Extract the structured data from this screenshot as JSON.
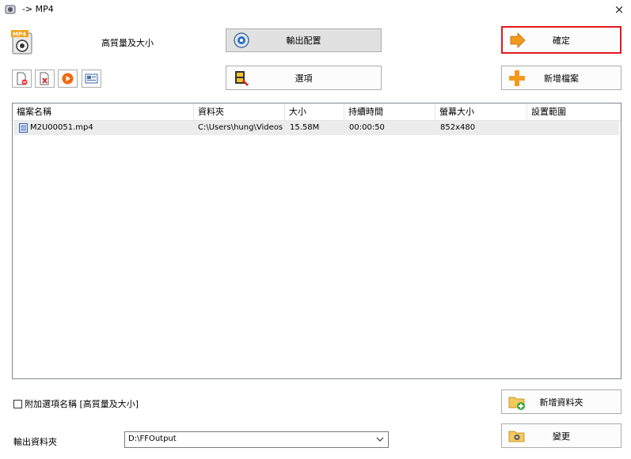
{
  "window": {
    "title": "-> MP4",
    "close_symbol": "×"
  },
  "profile": {
    "name": "高質量及大小"
  },
  "buttons": {
    "output_settings": "輸出配置",
    "options": "選項",
    "ok": "確定",
    "add_file": "新增檔案",
    "add_folder": "新增資料夾",
    "change": "變更"
  },
  "toolbar": [
    "remove-file-icon",
    "clear-list-icon",
    "play-icon",
    "media-info-icon"
  ],
  "list": {
    "columns": [
      "檔案名稱",
      "資料夾",
      "大小",
      "持續時間",
      "螢幕大小",
      "設置範圍"
    ],
    "rows": [
      {
        "name": "M2U00051.mp4",
        "folder": "C:\\Users\\hung\\Videos",
        "size": "15.58M",
        "duration": "00:00:50",
        "screen": "852x480",
        "range": ""
      }
    ]
  },
  "append_option": {
    "label": "附加選項名稱 [高質量及大小]",
    "checked": false
  },
  "output_folder": {
    "label": "輸出資料夾",
    "value": "D:\\FFOutput"
  },
  "colors": {
    "highlight_border": "#e0191f",
    "row_bg": "#ececec",
    "button_face": "#e1e1e1"
  }
}
